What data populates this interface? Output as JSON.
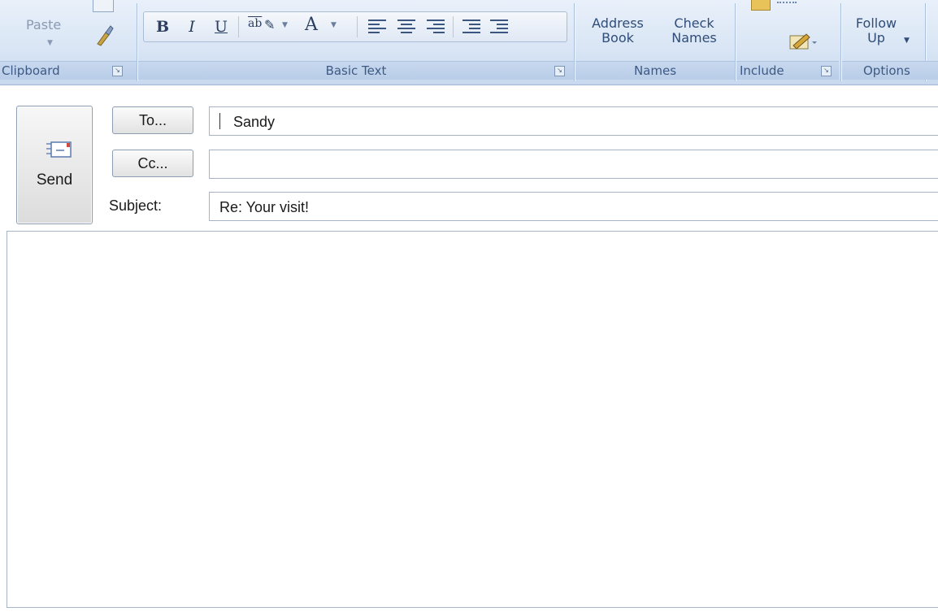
{
  "ribbon": {
    "clipboard": {
      "paste_label": "Paste",
      "group_label": "Clipboard"
    },
    "basic_text": {
      "bold": "B",
      "italic": "I",
      "underline": "U",
      "highlight": "ab",
      "font_color": "A",
      "group_label": "Basic Text"
    },
    "names": {
      "address_book": "Address Book",
      "check_names": "Check Names",
      "group_label": "Names"
    },
    "include": {
      "group_label": "Include"
    },
    "options": {
      "follow_up": "Follow Up",
      "group_label": "Options"
    }
  },
  "header": {
    "send_label": "Send",
    "to_button": "To...",
    "cc_button": "Cc...",
    "subject_label": "Subject:",
    "to_value": "Sandy",
    "cc_value": "",
    "subject_value": "Re: Your visit!"
  },
  "body": {
    "text": ""
  },
  "colors": {
    "ribbon_bg": "#dae6f5",
    "group_label_text": "#3e5a84",
    "border": "#a6b4c8"
  }
}
